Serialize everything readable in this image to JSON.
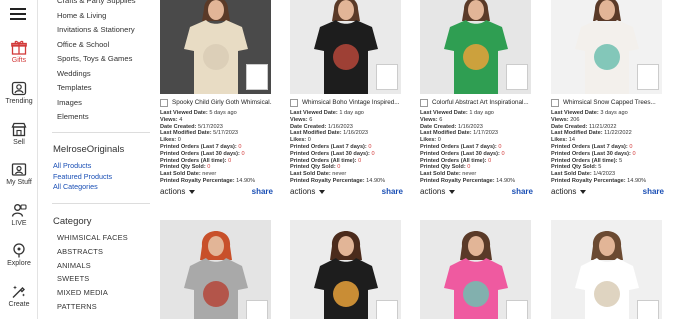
{
  "rail": {
    "items": [
      {
        "label": "Gifts",
        "icon": "gift-icon"
      },
      {
        "label": "Trending",
        "icon": "trending-icon"
      },
      {
        "label": "Sell",
        "icon": "store-icon"
      },
      {
        "label": "My Stuff",
        "icon": "my-stuff-icon"
      },
      {
        "label": "LIVE",
        "icon": "live-icon"
      },
      {
        "label": "Explore",
        "icon": "compass-icon"
      },
      {
        "label": "Create",
        "icon": "create-icon"
      }
    ],
    "active_color": "#d23a3a"
  },
  "categories_top": [
    "Crafts & Party Supplies",
    "Home & Living",
    "Invitations & Stationery",
    "Office & School",
    "Sports, Toys & Games",
    "Weddings",
    "Templates",
    "Images",
    "Elements"
  ],
  "store": {
    "name": "MelroseOriginals",
    "links": [
      "All Products",
      "Featured Products",
      "All Categories"
    ]
  },
  "category_section": {
    "title": "Category",
    "items": [
      "WHIMSICAL FACES",
      "ABSTRACTS",
      "ANIMALS",
      "SWEETS",
      "MIXED MEDIA",
      "PATTERNS"
    ]
  },
  "labels": {
    "last_viewed": "Last Viewed Date:",
    "views": "Views:",
    "date_created": "Date Created:",
    "last_modified": "Last Modified Date:",
    "likes": "Likes:",
    "printed_7": "Printed Orders (Last 7 days):",
    "printed_30": "Printed Orders (Last 30 days):",
    "printed_all": "Printed Orders (All time):",
    "printed_qty": "Printed Qty Sold:",
    "last_sold": "Last Sold Date:",
    "royalty": "Printed Royalty Percentage:",
    "actions": "actions",
    "share": "share"
  },
  "products": [
    {
      "title": "Spooky Child Girly Goth Whimsical...",
      "last_viewed": "5 days ago",
      "views": "4",
      "created": "5/17/2023",
      "modified": "5/17/2023",
      "likes": "0",
      "p7": "0",
      "p30": "0",
      "pall": "0",
      "qty": "0",
      "last_sold": "never",
      "royalty": "14.90%"
    },
    {
      "title": "Whimsical Boho Vintage Inspired...",
      "last_viewed": "1 day ago",
      "views": "6",
      "created": "1/16/2023",
      "modified": "1/16/2023",
      "likes": "0",
      "p7": "0",
      "p30": "0",
      "pall": "0",
      "qty": "0",
      "last_sold": "never",
      "royalty": "14.90%"
    },
    {
      "title": "Colorful Abstract Art Inspirational...",
      "last_viewed": "1 day ago",
      "views": "6",
      "created": "1/16/2023",
      "modified": "1/17/2023",
      "likes": "0",
      "p7": "0",
      "p30": "0",
      "pall": "0",
      "qty": "0",
      "last_sold": "never",
      "royalty": "14.90%"
    },
    {
      "title": "Whimsical Snow Capped Trees...",
      "last_viewed": "3 days ago",
      "views": "206",
      "created": "11/21/2022",
      "modified": "11/22/2022",
      "likes": "14",
      "p7": "0",
      "p30": "0",
      "pall": "5",
      "qty": "5",
      "last_sold": "1/4/2023",
      "royalty": "14.90%"
    }
  ],
  "shirt_colors": [
    "#e8dcc4",
    "#1d1d1d",
    "#2f9e52",
    "#f3f0ec",
    "#a9a9a9",
    "#1d1d1d",
    "#ef5aa0",
    "#ffffff"
  ]
}
